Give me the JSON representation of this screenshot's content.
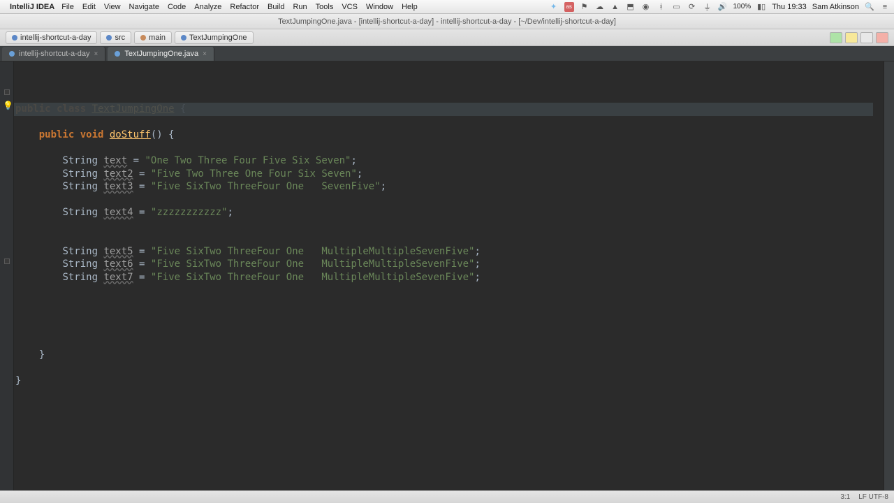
{
  "menubar": {
    "app_name": "IntelliJ IDEA",
    "menus": [
      "File",
      "Edit",
      "View",
      "Navigate",
      "Code",
      "Analyze",
      "Refactor",
      "Build",
      "Run",
      "Tools",
      "VCS",
      "Window",
      "Help"
    ],
    "battery": "100%",
    "clock": "Thu 19:33",
    "user": "Sam Atkinson"
  },
  "window_title": "TextJumpingOne.java - [intellij-shortcut-a-day] - intellij-shortcut-a-day - [~/Dev/intellij-shortcut-a-day]",
  "breadcrumbs": [
    "intellij-shortcut-a-day",
    "src",
    "main",
    "TextJumpingOne"
  ],
  "tabs": [
    {
      "label": "intellij-shortcut-a-day",
      "active": false
    },
    {
      "label": "TextJumpingOne.java",
      "active": true
    }
  ],
  "code": {
    "class_kw": "public class ",
    "class_name": "TextJumpingOne",
    "open_brace": " {",
    "method_sig_pre": "    public void ",
    "method_name": "doStuff",
    "method_sig_post": "() {",
    "lines": [
      {
        "indent": "        ",
        "type": "String ",
        "var": "text",
        "eq": " = ",
        "str": "\"One Two Three Four Five Six Seven\"",
        "semi": ";"
      },
      {
        "indent": "        ",
        "type": "String ",
        "var": "text2",
        "eq": " = ",
        "str": "\"Five Two Three One Four Six Seven\"",
        "semi": ";"
      },
      {
        "indent": "        ",
        "type": "String ",
        "var": "text3",
        "eq": " = ",
        "str": "\"Five SixTwo ThreeFour One   SevenFive\"",
        "semi": ";"
      },
      {
        "blank": true
      },
      {
        "indent": "        ",
        "type": "String ",
        "var": "text4",
        "eq": " = ",
        "str": "\"zzzzzzzzzzz\"",
        "semi": ";"
      },
      {
        "blank": true
      },
      {
        "blank": true
      },
      {
        "indent": "        ",
        "type": "String ",
        "var": "text5",
        "eq": " = ",
        "str": "\"Five SixTwo ThreeFour One   MultipleMultipleSevenFive\"",
        "semi": ";"
      },
      {
        "indent": "        ",
        "type": "String ",
        "var": "text6",
        "eq": " = ",
        "str": "\"Five SixTwo ThreeFour One   MultipleMultipleSevenFive\"",
        "semi": ";"
      },
      {
        "indent": "        ",
        "type": "String ",
        "var": "text7",
        "eq": " = ",
        "str": "\"Five SixTwo ThreeFour One   MultipleMultipleSevenFive\"",
        "semi": ";"
      }
    ],
    "close_method": "    }",
    "close_class": "}"
  },
  "status": {
    "pos": "3:1",
    "enc": "LF UTF-8"
  }
}
